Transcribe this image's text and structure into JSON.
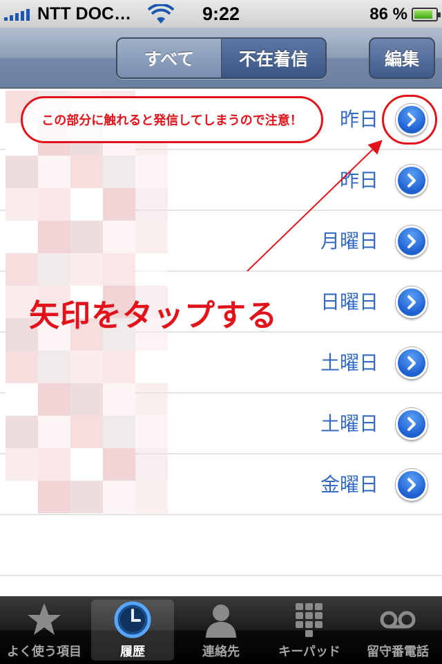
{
  "status_bar": {
    "carrier": "NTT DOC…",
    "time": "9:22",
    "battery_percent": "86 %",
    "battery_level": 0.86
  },
  "nav": {
    "segments": [
      "すべて",
      "不在着信"
    ],
    "selected_segment": "不在着信",
    "edit_label": "編集"
  },
  "calls": [
    {
      "date": "昨日"
    },
    {
      "date": "昨日"
    },
    {
      "date": "月曜日"
    },
    {
      "date": "日曜日"
    },
    {
      "date": "土曜日"
    },
    {
      "date": "土曜日"
    },
    {
      "date": "金曜日"
    }
  ],
  "annotations": {
    "warning": "この部分に触れると発信してしまうので注意！",
    "instruction": "矢印をタップする",
    "color": "#e2121b"
  },
  "tabs": [
    {
      "label": "よく使う項目",
      "icon": "star-icon"
    },
    {
      "label": "履歴",
      "icon": "clock-icon",
      "selected": true
    },
    {
      "label": "連絡先",
      "icon": "person-icon"
    },
    {
      "label": "キーパッド",
      "icon": "keypad-icon"
    },
    {
      "label": "留守番電話",
      "icon": "voicemail-icon"
    }
  ],
  "colors": {
    "link_blue": "#3469c6",
    "nav_blue": "#6b7fa0"
  }
}
